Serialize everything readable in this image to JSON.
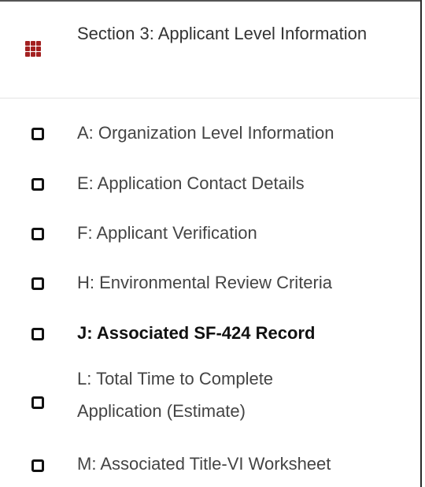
{
  "section": {
    "title": "Section 3: Applicant Level Information",
    "icon": "grid-icon",
    "icon_color": "#a32121"
  },
  "nav": {
    "items": [
      {
        "label": "A: Organization Level Information",
        "active": false
      },
      {
        "label": "E: Application Contact Details",
        "active": false
      },
      {
        "label": "F: Applicant Verification",
        "active": false
      },
      {
        "label": "H: Environmental Review Criteria",
        "active": false
      },
      {
        "label": "J: Associated SF-424 Record",
        "active": true
      },
      {
        "label": "L: Total Time to Complete Application (Estimate)",
        "active": false
      },
      {
        "label": "M: Associated Title-VI Worksheet",
        "active": false
      }
    ]
  }
}
